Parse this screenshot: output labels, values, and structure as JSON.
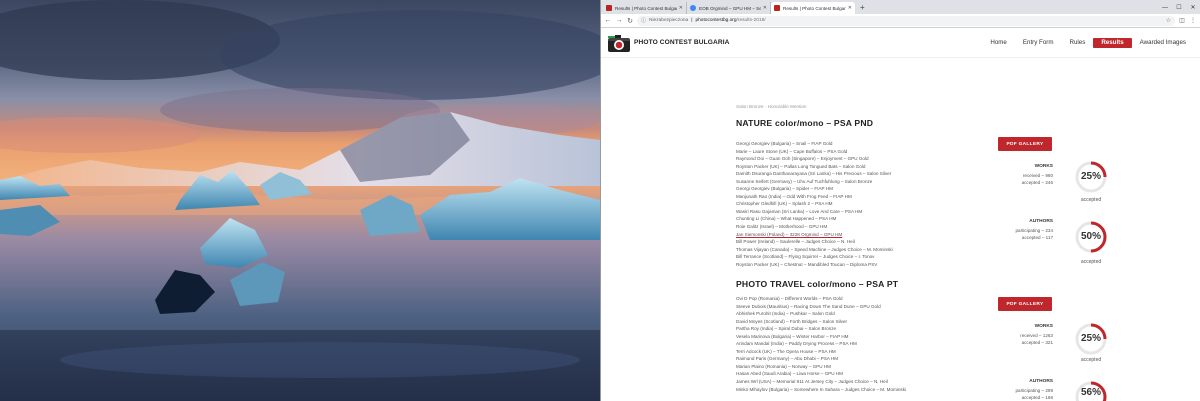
{
  "browser": {
    "tabs": [
      {
        "label": "Results | Photo Contest Bulgaria",
        "favicon": "red"
      },
      {
        "label": "EOB Orgmind – GPU HM – Sek…",
        "favicon": "google"
      },
      {
        "label": "Results | Photo Contest Bulgaria",
        "favicon": "red",
        "active": true
      }
    ],
    "new_tab": "+",
    "security_text": "Niezabezpieczona",
    "url_host": "photocontestbg.org",
    "url_path": "/results-2018/"
  },
  "site": {
    "brand": "PHOTO CONTEST BULGARIA",
    "nav": [
      {
        "label": "Home"
      },
      {
        "label": "Entry Form"
      },
      {
        "label": "Rules"
      },
      {
        "label": "Results",
        "active": true
      },
      {
        "label": "Awarded Images"
      }
    ],
    "cut_text": "Salon Bronze · Honorable Mention"
  },
  "sections": [
    {
      "title": "NATURE color/mono – PSA PND",
      "pdf_label": "PDF GALLERY",
      "entries": [
        "Georgi Georgiev (Bulgaria) – Snail – FIAP Gold",
        "Marie – Laure Stone (UK) – Cape Buffalos – PSA Gold",
        "Raymond Ooi – Guan Goh (Singapore) – Enjoyment – GPU Gold",
        "Royston Packer (UK) – Pallas Long Tongued Bats – Salon Gold",
        "Damith Dsuranga Danthanarayana (Sri Lanka) – His Precious – Salon Silver",
        "Susanne Seifert (Germany) – Uhu Auf Tuchfuhlung – Salon Bronze",
        "Georgi Georgiev (Bulgaria) – Spider – FIAP HM",
        "Manjunath Rao (India) – Odd With Frog Feed – FIAP HM",
        "Christopher Gledhill (UK) – Splash 2 – PSA HM",
        "Wasiri Rasu Gajaman (Sri Lanka) – Love And Care – PSA HM",
        "Chunting Li (China) – What Happened – PSA HM",
        "Roie Galitz (Israel) – Motherhood – GPU HM",
        "Jan Siemonski (Poland) – 3228 Orgmind – GPU HM",
        "Bill Power (Ireland) – Saulerelle – Judges Choice – N. Heil",
        "Thomas Vijayan (Canada) – Speed Machine – Judges Choice – M. Mominski",
        "Bill Terrance (Scotland) – Flying Squirrel – Judges Choice – I. Tonov",
        "Royston Packer (UK) – Chestnut – Mandibled Toucan – Diploma PSV"
      ],
      "highlight_index": 12,
      "works": {
        "label": "WORKS",
        "received": "received – 960",
        "accepted": "accepted – 246",
        "percent": 25,
        "percent_text": "25%",
        "caption": "accepted"
      },
      "authors": {
        "label": "AUTHORS",
        "participating": "participating – 234",
        "accepted": "accepted – 117",
        "percent": 50,
        "percent_text": "50%",
        "caption": "accepted"
      }
    },
    {
      "title": "PHOTO TRAVEL color/mono – PSA PT",
      "pdf_label": "PDF GALLERY",
      "entries": [
        "Ovi D Pop (Romania) – Different Worlds – PSA Gold",
        "Steeve Dubois (Mauritius) – Racing Down The Sand Dune – GPU Gold",
        "Abhishek Purohit (India) – Pushkar – Salon Gold",
        "David Moyes (Scotland) – Forth Bridges – Salon Silver",
        "Partha Roy (India) – Spiral Dubai – Salon Bronze",
        "Vesela Marinova (Bulgaria) – Winter Harbor – FIAP HM",
        "Arindam Mandal (India) – Paddy Drying Process – PSA HM",
        "Terri Adcock (UK) – The Opera House – PSA HM",
        "Raimund Paris (Germany) – Abu Dhabi – PSA HM",
        "Marian Plaino (Romania) – Norway – GPU HM",
        "Hasan Abed (Saudi Arabia) – Liwa Horse – GPU HM",
        "James Wrl (USA) – Memorial 911 At Jersey City – Judges Choice – N. Heil",
        "Minko Mihaylov (Bulgaria) – Somewhere In Sahara – Judges Choice – M. Mominski"
      ],
      "highlight_index": -1,
      "works": {
        "label": "WORKS",
        "received": "received – 1263",
        "accepted": "accepted – 321",
        "percent": 25,
        "percent_text": "25%",
        "caption": "accepted"
      },
      "authors": {
        "label": "AUTHORS",
        "participating": "participating – 299",
        "accepted": "accepted – 166",
        "percent": 56,
        "percent_text": "56%",
        "caption": "accepted"
      }
    }
  ],
  "colors": {
    "accent": "#c0272d",
    "gauge_track": "#e6e6e6"
  }
}
